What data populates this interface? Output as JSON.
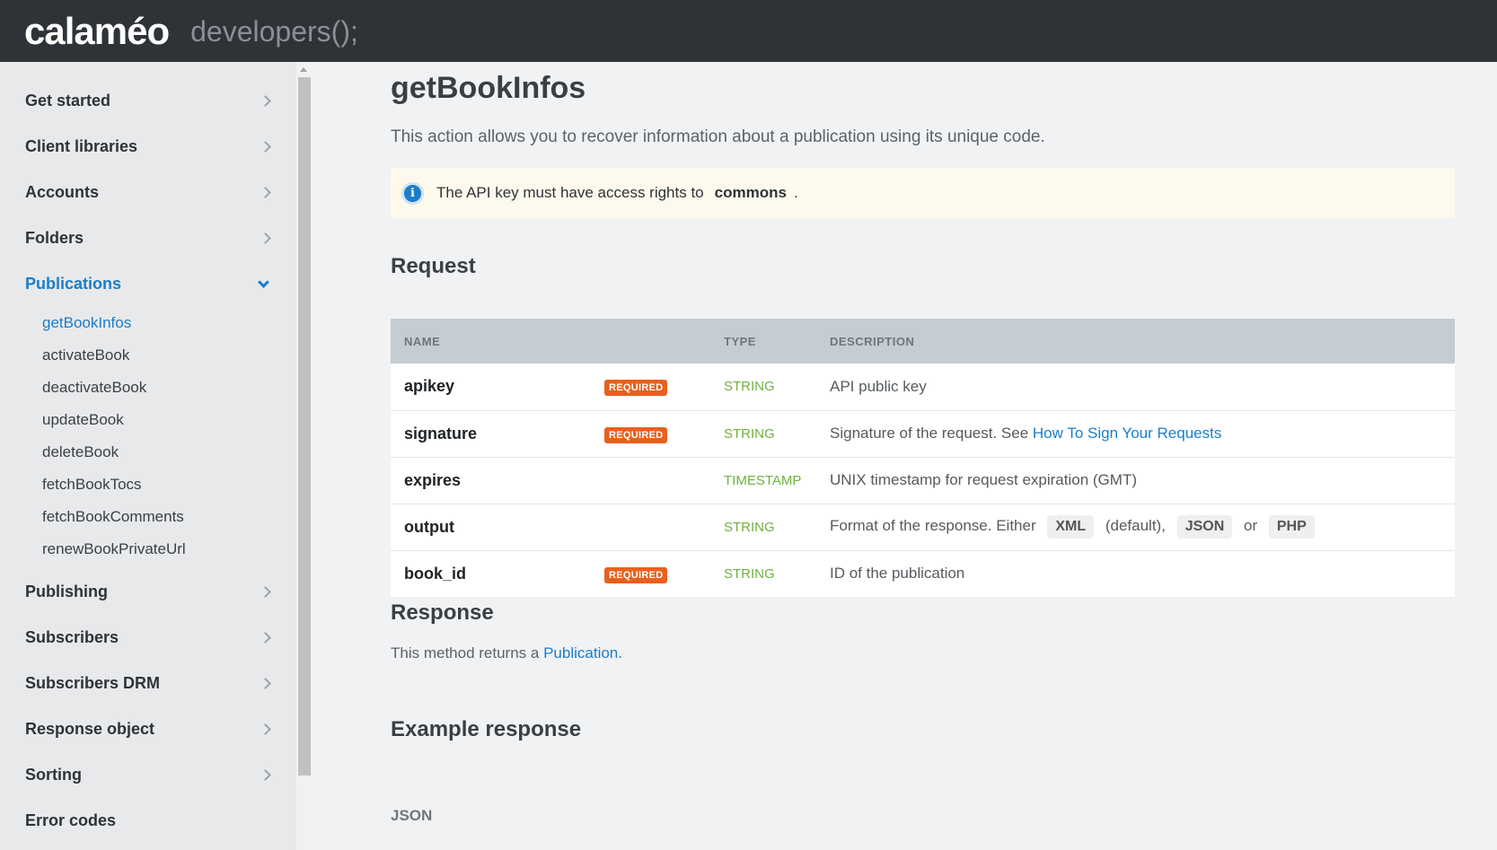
{
  "header": {
    "logo": "calaméo",
    "subtitle": "developers();"
  },
  "sidebar": {
    "items_top": [
      {
        "label": "Get started"
      },
      {
        "label": "Client libraries"
      },
      {
        "label": "Accounts"
      },
      {
        "label": "Folders"
      }
    ],
    "active_section": {
      "label": "Publications"
    },
    "sub_items": [
      {
        "label": "getBookInfos"
      },
      {
        "label": "activateBook"
      },
      {
        "label": "deactivateBook"
      },
      {
        "label": "updateBook"
      },
      {
        "label": "deleteBook"
      },
      {
        "label": "fetchBookTocs"
      },
      {
        "label": "fetchBookComments"
      },
      {
        "label": "renewBookPrivateUrl"
      }
    ],
    "items_bottom": [
      {
        "label": "Publishing"
      },
      {
        "label": "Subscribers"
      },
      {
        "label": "Subscribers DRM"
      },
      {
        "label": "Response object"
      },
      {
        "label": "Sorting"
      },
      {
        "label": "Error codes"
      }
    ]
  },
  "main": {
    "title": "getBookInfos",
    "intro": "This action allows you to recover information about a publication using its unique code.",
    "notice": {
      "icon": "info-icon",
      "text": "The API key must have access rights to",
      "code": "commons",
      "suffix": "."
    },
    "request_heading": "Request",
    "table": {
      "headers": [
        "NAME",
        "",
        "TYPE",
        "DESCRIPTION"
      ],
      "required_label": "REQUIRED",
      "rows": [
        {
          "name": "apikey",
          "type": "STRING",
          "desc": "API public key"
        },
        {
          "name": "signature",
          "type": "STRING",
          "desc": "Signature of the request. See",
          "link": "How To Sign Your Requests"
        },
        {
          "name": "expires",
          "type": "TIMESTAMP",
          "desc": "UNIX timestamp for request expiration (GMT)"
        },
        {
          "name": "output",
          "type": "STRING",
          "desc": "Format of the response. Either",
          "opt1": "XML",
          "mid": "(default),",
          "opt2": "JSON",
          "or": "or",
          "opt3": "PHP"
        },
        {
          "name": "book_id",
          "type": "STRING",
          "desc": "ID of the publication"
        }
      ]
    },
    "response_heading": "Response",
    "response_text": "This method returns a",
    "response_link": "Publication",
    "response_suffix": ".",
    "example_heading": "Example response",
    "json_label": "JSON"
  },
  "colors": {
    "topbar": "#2f3337",
    "accent": "#1a7ec9",
    "required": "#e8601c",
    "type": "#6fb13e"
  }
}
